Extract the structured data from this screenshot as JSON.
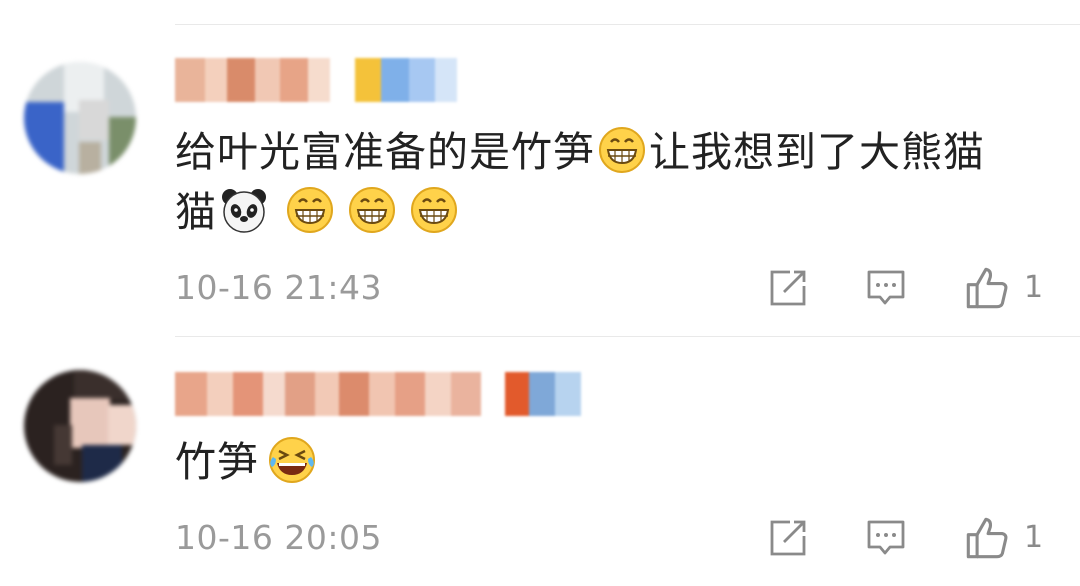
{
  "comments": [
    {
      "username": "",
      "text_parts": [
        "给叶光富准备的是竹笋",
        "让我想到了大熊猫"
      ],
      "emojis": [
        "grinning-face-icon",
        "panda-icon",
        "grinning-face-icon",
        "grinning-face-icon",
        "grinning-face-icon"
      ],
      "time": "10-16 21:43",
      "likes": "1"
    },
    {
      "username": "",
      "text_parts": [
        "竹笋"
      ],
      "emojis": [
        "laughing-tears-face-icon"
      ],
      "time": "10-16 20:05",
      "likes": "1"
    }
  ],
  "colors": {
    "text": "#222222",
    "meta": "#9a9a9a",
    "divider": "#e9e9e9",
    "icon": "#8a8a8a",
    "emoji_face": "#ffd24a"
  }
}
